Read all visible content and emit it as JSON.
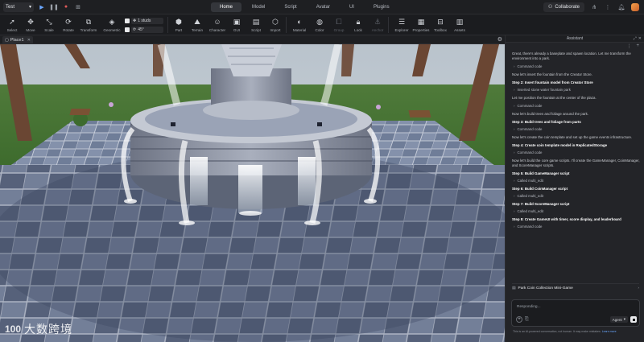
{
  "topbar": {
    "file_name": "Test",
    "tabs": [
      {
        "label": "Home",
        "active": true
      },
      {
        "label": "Model",
        "active": false
      },
      {
        "label": "Script",
        "active": false
      },
      {
        "label": "Avatar",
        "active": false
      },
      {
        "label": "UI",
        "active": false
      },
      {
        "label": "Plugins",
        "active": false
      }
    ],
    "collaborate_label": "Collaborate"
  },
  "ribbon": {
    "tools_left": [
      {
        "label": "Select",
        "icon": "cursor-icon"
      },
      {
        "label": "Move",
        "icon": "move-arrows-icon"
      },
      {
        "label": "Scale",
        "icon": "scale-icon"
      },
      {
        "label": "Rotate",
        "icon": "rotate-icon"
      },
      {
        "label": "Transform",
        "icon": "transform-icon"
      },
      {
        "label": "Geometric",
        "icon": "geometric-icon"
      }
    ],
    "snap_move": "1 studs",
    "snap_rotate": "45°",
    "tools_right": [
      {
        "label": "Part",
        "icon": "part-cube-icon"
      },
      {
        "label": "Terrain",
        "icon": "terrain-icon"
      },
      {
        "label": "Character",
        "icon": "character-icon"
      },
      {
        "label": "GUI",
        "icon": "gui-icon"
      },
      {
        "label": "Script",
        "icon": "script-icon"
      },
      {
        "label": "Import",
        "icon": "import-icon"
      },
      {
        "label": "Material",
        "icon": "material-icon"
      },
      {
        "label": "Color",
        "icon": "color-icon"
      },
      {
        "label": "Group",
        "icon": "group-icon"
      },
      {
        "label": "Lock",
        "icon": "lock-icon"
      },
      {
        "label": "Anchor",
        "icon": "anchor-icon"
      },
      {
        "label": "Explorer",
        "icon": "explorer-icon"
      },
      {
        "label": "Properties",
        "icon": "properties-icon"
      },
      {
        "label": "Toolbox",
        "icon": "toolbox-icon"
      },
      {
        "label": "Assets",
        "icon": "assets-icon"
      }
    ]
  },
  "viewport": {
    "tab_label": "Place1"
  },
  "watermark": {
    "logo": "100",
    "text": "大数跨境"
  },
  "assistant": {
    "title": "Assistant",
    "messages": [
      {
        "kind": "text",
        "text": "Great, there's already a baseplate and spawn location. Let me transform the environment into a park."
      },
      {
        "kind": "code",
        "text": "Command code"
      },
      {
        "kind": "text",
        "text": "Now let's insert the fountain from the Creator Store."
      },
      {
        "kind": "step",
        "text": "Step 2: Insert fountain model from Creator Store"
      },
      {
        "kind": "code",
        "text": "Inserted stone water fountain park"
      },
      {
        "kind": "text",
        "text": "Let me position the fountain at the center of the plaza."
      },
      {
        "kind": "code",
        "text": "Command code"
      },
      {
        "kind": "text",
        "text": "Now let's build trees and foliage around the park."
      },
      {
        "kind": "step",
        "text": "Step 3: Build trees and foliage from parts"
      },
      {
        "kind": "code",
        "text": "Command code"
      },
      {
        "kind": "text",
        "text": "Now let's create the coin template and set up the game events infrastructure."
      },
      {
        "kind": "step",
        "text": "Step 4: Create coin template model in ReplicatedStorage"
      },
      {
        "kind": "code",
        "text": "Command code"
      },
      {
        "kind": "text",
        "text": "Now let's build the core game scripts. I'll create the GameManager, CoinManager, and ScoreManager scripts."
      },
      {
        "kind": "step",
        "text": "Step 5: Build GameManager script"
      },
      {
        "kind": "code",
        "text": "Called multi_edit"
      },
      {
        "kind": "step",
        "text": "Step 6: Build CoinManager script"
      },
      {
        "kind": "code",
        "text": "Called multi_edit"
      },
      {
        "kind": "step",
        "text": "Step 7: Build ScoreManager script"
      },
      {
        "kind": "code",
        "text": "Called multi_edit"
      },
      {
        "kind": "step",
        "text": "Step 8: Create GameUI with timer, score display, and leaderboard"
      },
      {
        "kind": "code",
        "text": "Command code"
      }
    ],
    "project_title": "Park Coin Collection Mini-Game",
    "input_placeholder": "Responding...",
    "mode_label": "Agent",
    "disclaimer": "This is an AI-powered conversation, not human. It may make mistakes.",
    "learn_more": "Learn more"
  }
}
